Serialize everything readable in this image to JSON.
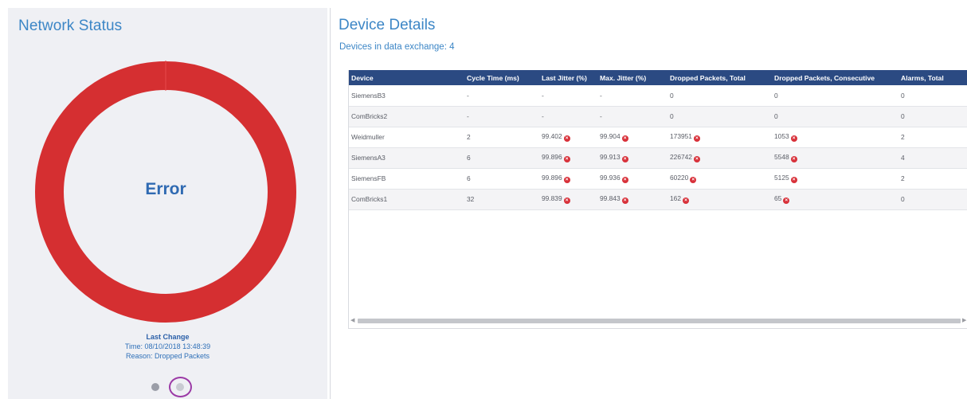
{
  "network_status": {
    "title": "Network Status",
    "status": "Error",
    "ring_color": "#d52f31",
    "last_change_title": "Last Change",
    "last_change_time": "Time: 08/10/2018 13:48:39",
    "last_change_reason": "Reason: Dropped Packets"
  },
  "device_details": {
    "title": "Device Details",
    "subtitle": "Devices in data exchange: 4",
    "columns": [
      "Device",
      "Cycle Time (ms)",
      "Last Jitter (%)",
      "Max. Jitter (%)",
      "Dropped Packets, Total",
      "Dropped Packets, Consecutive",
      "Alarms, Total"
    ],
    "rows": [
      {
        "device": "SiemensB3",
        "cycle": "-",
        "last_jitter": "-",
        "max_jitter": "-",
        "dropped_total": "0",
        "dropped_consec": "0",
        "alarms": "0",
        "err_last": false,
        "err_max": false,
        "err_total": false,
        "err_consec": false
      },
      {
        "device": "ComBricks2",
        "cycle": "-",
        "last_jitter": "-",
        "max_jitter": "-",
        "dropped_total": "0",
        "dropped_consec": "0",
        "alarms": "0",
        "err_last": false,
        "err_max": false,
        "err_total": false,
        "err_consec": false
      },
      {
        "device": "Weidmuller",
        "cycle": "2",
        "last_jitter": "99.402",
        "max_jitter": "99.904",
        "dropped_total": "173951",
        "dropped_consec": "1053",
        "alarms": "2",
        "err_last": true,
        "err_max": true,
        "err_total": true,
        "err_consec": true
      },
      {
        "device": "SiemensA3",
        "cycle": "6",
        "last_jitter": "99.896",
        "max_jitter": "99.913",
        "dropped_total": "226742",
        "dropped_consec": "5548",
        "alarms": "4",
        "err_last": true,
        "err_max": true,
        "err_total": true,
        "err_consec": true
      },
      {
        "device": "SiemensFB",
        "cycle": "6",
        "last_jitter": "99.896",
        "max_jitter": "99.936",
        "dropped_total": "60220",
        "dropped_consec": "5125",
        "alarms": "2",
        "err_last": true,
        "err_max": true,
        "err_total": true,
        "err_consec": true
      },
      {
        "device": "ComBricks1",
        "cycle": "32",
        "last_jitter": "99.839",
        "max_jitter": "99.843",
        "dropped_total": "162",
        "dropped_consec": "65",
        "alarms": "0",
        "err_last": true,
        "err_max": true,
        "err_total": true,
        "err_consec": true
      }
    ]
  },
  "pager": {
    "pages": 2,
    "current": 2
  },
  "icons": {
    "error": "error-x-icon",
    "scroll_left": "scroll-left-arrow-icon",
    "scroll_right": "scroll-right-arrow-icon"
  }
}
